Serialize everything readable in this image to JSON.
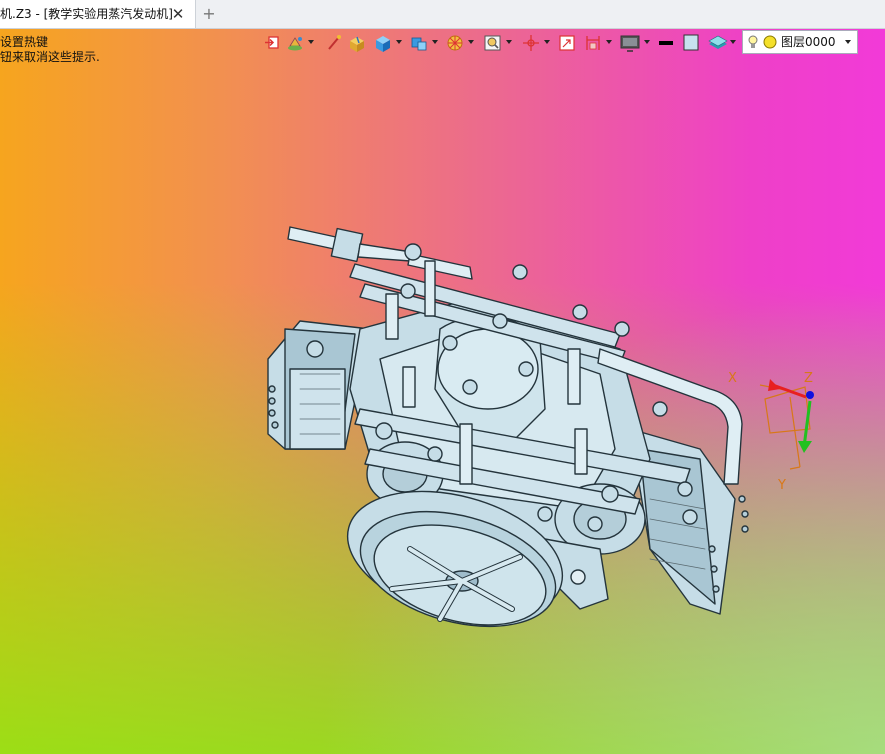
{
  "tab": {
    "title": "机.Z3 - [教学实验用蒸汽发动机]",
    "close_glyph": "✕",
    "new_tab_glyph": "+"
  },
  "hints": {
    "line1": "设置热键",
    "line2": "钮来取消这些提示."
  },
  "toolbar": {
    "icons": [
      "exit-sketch-icon",
      "paint-icon",
      "line-tool-icon",
      "box-icon",
      "cube-icon",
      "view-cube-icon",
      "shading-wheel-icon",
      "zoom-box-icon",
      "axis-icon",
      "view-orient-icon",
      "dimension-icon",
      "display-icon",
      "line-color-icon",
      "fill-color-icon",
      "layer-stack-icon"
    ],
    "layer": {
      "label": "图层0000"
    }
  },
  "triad": {
    "z_label": "Z",
    "x_label": "X",
    "y_label": "Y"
  },
  "colors": {
    "model_fill": "#c6dde7",
    "model_edge": "#24343c",
    "axis_x": "#e82020",
    "axis_y": "#22c020",
    "axis_z": "#1010e0",
    "triad_orange": "#d87818"
  }
}
